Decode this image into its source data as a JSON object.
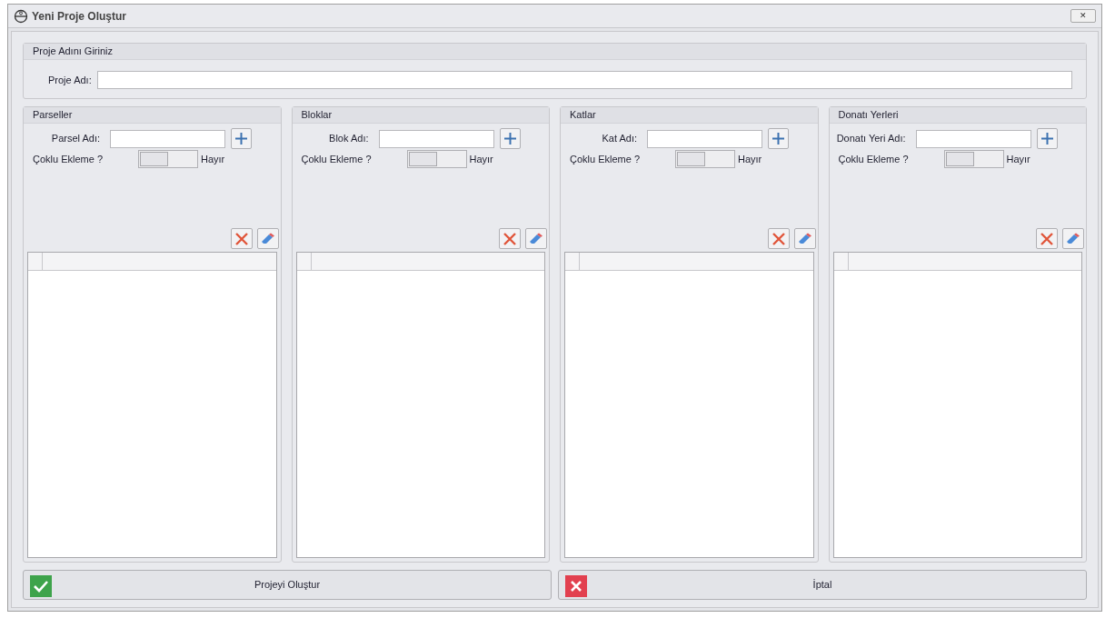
{
  "window": {
    "title": "Yeni Proje Oluştur",
    "close": "✕"
  },
  "project_group": {
    "title": "Proje Adını Giriniz",
    "label": "Proje Adı:"
  },
  "panels": [
    {
      "title": "Parseller",
      "field_label": "Parsel Adı:",
      "multi_label": "Çoklu Ekleme ?",
      "multi_on": false,
      "multi_text": "Hayır"
    },
    {
      "title": "Bloklar",
      "field_label": "Blok Adı:",
      "multi_label": "Çoklu Ekleme ?",
      "multi_on": false,
      "multi_text": "Hayır"
    },
    {
      "title": "Katlar",
      "field_label": "Kat Adı:",
      "multi_label": "Çoklu Ekleme ?",
      "multi_on": false,
      "multi_text": "Hayır"
    },
    {
      "title": "Donatı Yerleri",
      "field_label": "Donatı Yeri Adı:",
      "multi_label": "Çoklu Ekleme ?",
      "multi_on": false,
      "multi_text": "Hayır"
    }
  ],
  "buttons": [
    {
      "kind": "ok",
      "label": "Projeyi Oluştur"
    },
    {
      "kind": "cancel",
      "label": "İptal"
    }
  ]
}
